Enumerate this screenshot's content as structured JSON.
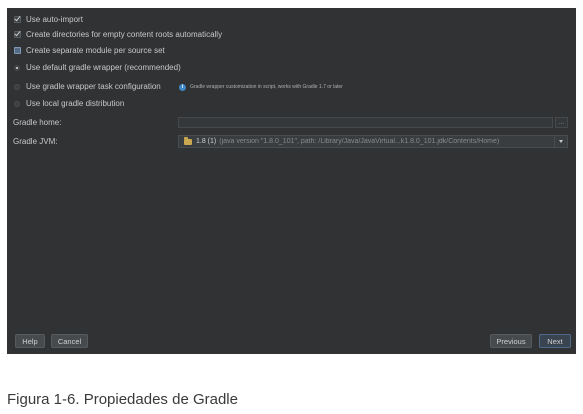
{
  "options": {
    "auto_import": "Use auto-import",
    "create_dirs": "Create directories for empty content roots automatically",
    "separate_module": "Create separate module per source set",
    "default_wrapper": "Use default gradle wrapper (recommended)",
    "wrapper_task": "Use gradle wrapper task configuration",
    "local_distribution": "Use local gradle distribution"
  },
  "info_note": "Gradle wrapper customization in script, works with Gradle 1.7 or later",
  "gradle_home": {
    "label": "Gradle home:",
    "value": "",
    "browse_label": "..."
  },
  "gradle_jvm": {
    "label": "Gradle JVM:",
    "selected_main": "1.8 (1)",
    "selected_detail": "(java version \"1.8.0_101\", path: /Library/Java/JavaVirtual...k1.8.0_101.jdk/Contents/Home)"
  },
  "buttons": {
    "help": "Help",
    "cancel": "Cancel",
    "previous": "Previous",
    "next": "Next"
  },
  "caption": "Figura 1-6. Propiedades de Gradle",
  "colors": {
    "dialog_bg": "#303234",
    "text": "#c8c8c8",
    "info_icon": "#3f88c5"
  }
}
